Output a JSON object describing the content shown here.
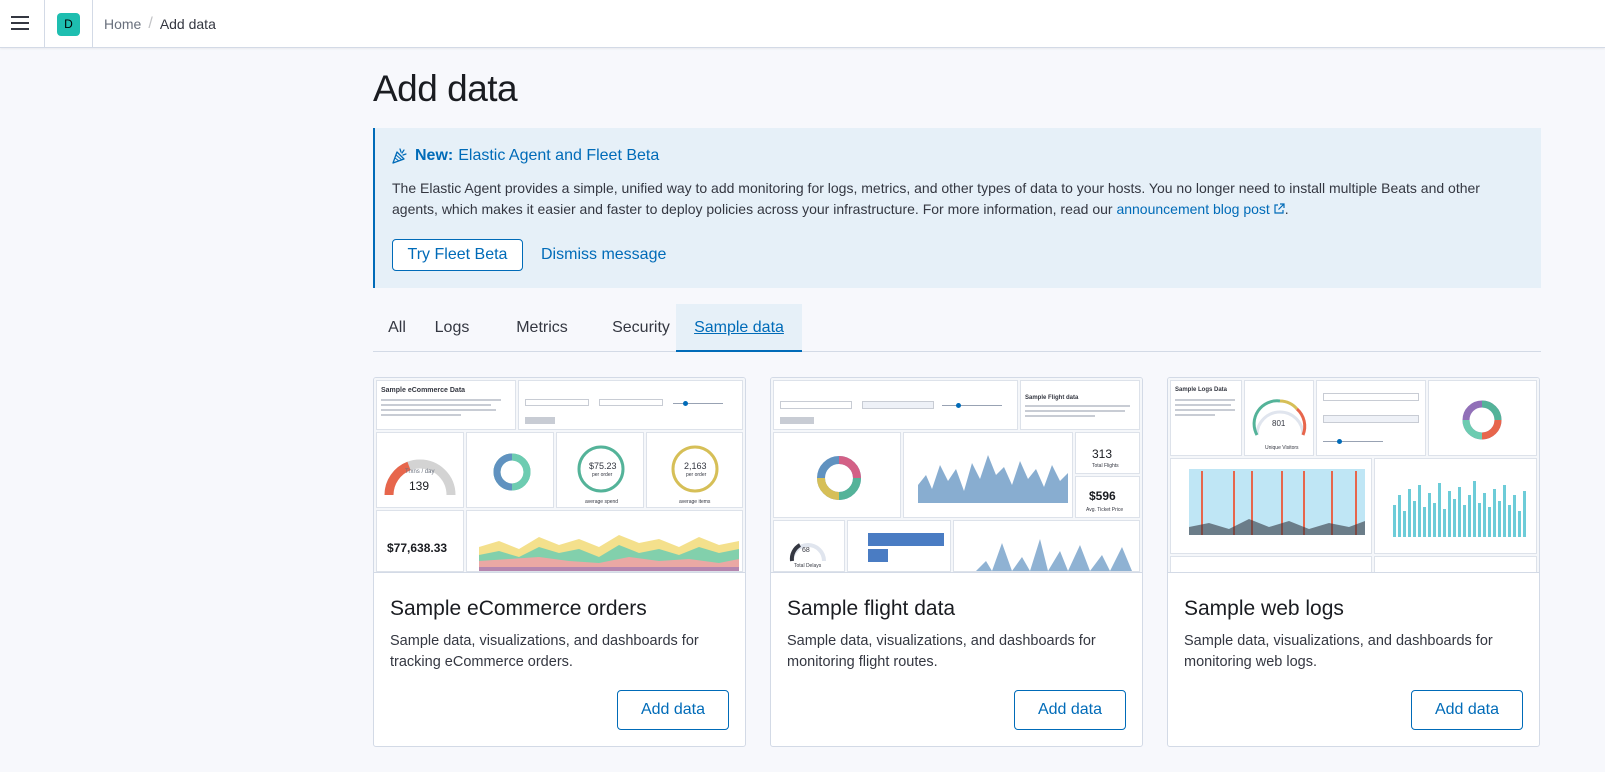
{
  "header": {
    "space_initial": "D",
    "breadcrumbs": [
      {
        "label": "Home"
      },
      {
        "label": "Add data"
      }
    ]
  },
  "page": {
    "title": "Add data"
  },
  "callout": {
    "title_bold": "New:",
    "title_rest": "Elastic Agent and Fleet Beta",
    "body": "The Elastic Agent provides a simple, unified way to add monitoring for logs, metrics, and other types of data to your hosts. You no longer need to install multiple Beats and other agents, which makes it easier and faster to deploy policies across your infrastructure. For more information, read our",
    "link_text": "announcement blog post",
    "body_end": ".",
    "primary_button": "Try Fleet Beta",
    "secondary_button": "Dismiss message",
    "icon": "cheer-icon",
    "accent_color": "#006bb8"
  },
  "tabs": [
    {
      "label": "All",
      "selected": false
    },
    {
      "label": "Logs",
      "selected": false
    },
    {
      "label": "Metrics",
      "selected": false
    },
    {
      "label": "Security",
      "selected": false
    },
    {
      "label": "Sample data",
      "selected": true
    }
  ],
  "cards": [
    {
      "title": "Sample eCommerce orders",
      "description": "Sample data, visualizations, and dashboards for tracking eCommerce orders.",
      "button": "Add data",
      "thumb": {
        "heading": "Sample eCommerce Data",
        "gauge_value": "139",
        "gauge_label": "Trxns / day",
        "avg_price": "$75.23",
        "avg_price_sub": "per order",
        "avg_price_label": "average spend",
        "avg_items": "2,163",
        "avg_items_sub": "per order",
        "avg_items_label": "average items",
        "revenue": "$77,638.33"
      }
    },
    {
      "title": "Sample flight data",
      "description": "Sample data, visualizations, and dashboards for monitoring flight routes.",
      "button": "Add data",
      "thumb": {
        "heading": "Sample Flight data",
        "total_flights": "313",
        "total_flights_label": "Total Flights",
        "ticket_price": "$596",
        "ticket_price_label": "Avg. Ticket Price",
        "delays": "68",
        "delays_label": "Total Delays"
      }
    },
    {
      "title": "Sample web logs",
      "description": "Sample data, visualizations, and dashboards for monitoring web logs.",
      "button": "Add data",
      "thumb": {
        "heading": "Sample Logs Data",
        "gauge_value": "801",
        "gauge_label": "Unique Visitors"
      }
    }
  ]
}
